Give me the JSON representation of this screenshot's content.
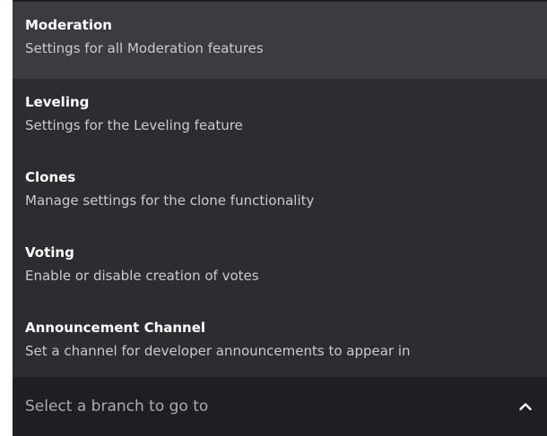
{
  "select": {
    "placeholder": "Select a branch to go to",
    "expanded": true,
    "options": [
      {
        "title": "Moderation",
        "description": "Settings for all Moderation features"
      },
      {
        "title": "Leveling",
        "description": "Settings for the Leveling feature"
      },
      {
        "title": "Clones",
        "description": "Manage settings for the clone functionality"
      },
      {
        "title": "Voting",
        "description": "Enable or disable creation of votes"
      },
      {
        "title": "Announcement Channel",
        "description": "Set a channel for developer announcements to appear in"
      }
    ],
    "icons": {
      "toggle": "chevron-up-icon"
    }
  },
  "colors": {
    "menu_background": "#2b2d31",
    "hover_background": "#3a3c42",
    "select_background": "#1e1f22",
    "title_text": "#ffffff",
    "description_text": "#c9cbd0",
    "placeholder_text": "#a9abb2"
  }
}
